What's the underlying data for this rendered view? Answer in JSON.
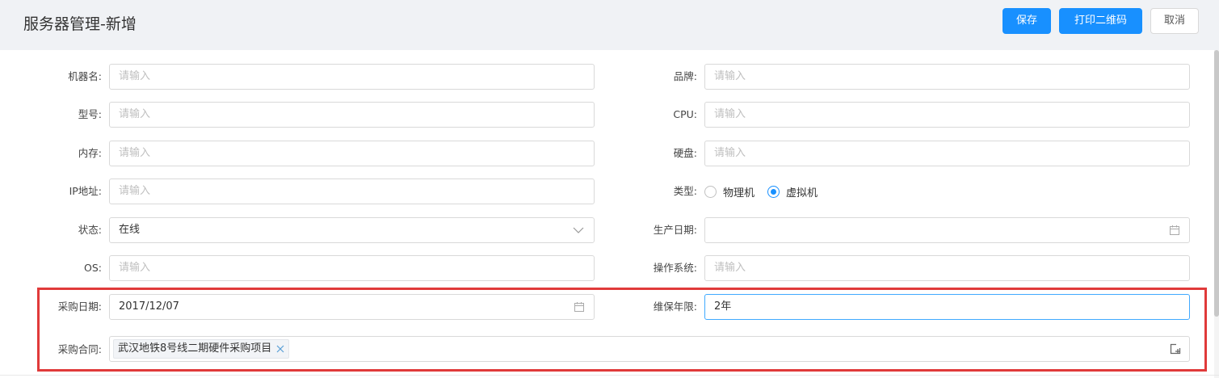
{
  "header": {
    "title": "服务器管理-新增",
    "save_label": "保存",
    "print_qr_label": "打印二维码",
    "cancel_label": "取消"
  },
  "form": {
    "machine_name": {
      "label": "机器名:",
      "placeholder": "请输入"
    },
    "brand": {
      "label": "品牌:",
      "placeholder": "请输入"
    },
    "model": {
      "label": "型号:",
      "placeholder": "请输入"
    },
    "cpu": {
      "label": "CPU:",
      "placeholder": "请输入"
    },
    "memory": {
      "label": "内存:",
      "placeholder": "请输入"
    },
    "disk": {
      "label": "硬盘:",
      "placeholder": "请输入"
    },
    "ip": {
      "label": "IP地址:",
      "placeholder": "请输入"
    },
    "type": {
      "label": "类型:",
      "options": [
        "物理机",
        "虚拟机"
      ],
      "selected": "虚拟机"
    },
    "status": {
      "label": "状态:",
      "value": "在线"
    },
    "production_date": {
      "label": "生产日期:",
      "value": ""
    },
    "os": {
      "label": "OS:",
      "placeholder": "请输入"
    },
    "operating_system": {
      "label": "操作系统:",
      "placeholder": "请输入"
    },
    "purchase_date": {
      "label": "采购日期:",
      "value": "2017/12/07"
    },
    "warranty": {
      "label": "维保年限:",
      "value": "2年"
    },
    "contract": {
      "label": "采购合同:",
      "tags": [
        "武汉地铁8号线二期硬件采购项目"
      ]
    }
  },
  "icons": {
    "calendar": "calendar-icon",
    "chevron": "chevron-down-icon",
    "tag_close": "close-icon",
    "add_select": "add-select-icon"
  },
  "colors": {
    "primary": "#1890ff",
    "highlight": "#e03a3a",
    "header_bg": "#f0f2f5"
  }
}
